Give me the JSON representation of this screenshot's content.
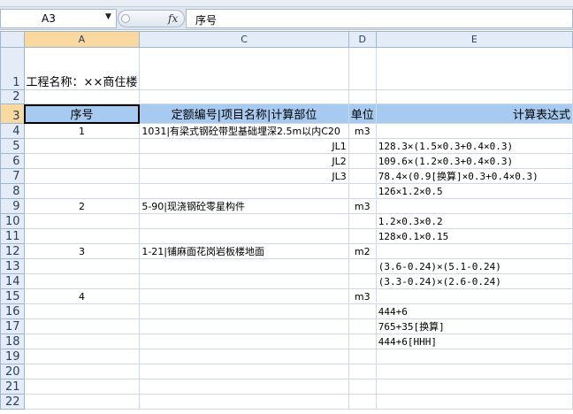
{
  "formula_bar": {
    "name_box": "A3",
    "fx_label": "fx",
    "formula": "序号"
  },
  "columns": [
    "",
    "A",
    "C",
    "D",
    "E"
  ],
  "rows": [
    {
      "n": "1",
      "a": "工程名称：××商住楼",
      "c": "",
      "d": "",
      "e": ""
    },
    {
      "n": "2",
      "a": "",
      "c": "",
      "d": "",
      "e": ""
    },
    {
      "n": "3",
      "a": "序号",
      "c": "定额编号|项目名称|计算部位",
      "d": "单位",
      "e": "计算表达式"
    },
    {
      "n": "4",
      "a": "1",
      "c": "1031|有梁式钢砼带型基础埋深2.5m以内C20",
      "d": "m3",
      "e": ""
    },
    {
      "n": "5",
      "a": "",
      "c": "JL1",
      "d": "",
      "e": "128.3×(1.5×0.3+0.4×0.3)"
    },
    {
      "n": "6",
      "a": "",
      "c": "JL2",
      "d": "",
      "e": "109.6×(1.2×0.3+0.4×0.3)"
    },
    {
      "n": "7",
      "a": "",
      "c": "JL3",
      "d": "",
      "e": "78.4×(0.9[换算]×0.3+0.4×0.3)"
    },
    {
      "n": "8",
      "a": "",
      "c": "",
      "d": "",
      "e": "126×1.2×0.5"
    },
    {
      "n": "9",
      "a": "2",
      "c": "5-90|现浇钢砼零星构件",
      "d": "m3",
      "e": ""
    },
    {
      "n": "10",
      "a": "",
      "c": "",
      "d": "",
      "e": "1.2×0.3×0.2"
    },
    {
      "n": "11",
      "a": "",
      "c": "",
      "d": "",
      "e": "128×0.1×0.15"
    },
    {
      "n": "12",
      "a": "3",
      "c": "1-21|铺麻面花岗岩板楼地面",
      "d": "m2",
      "e": ""
    },
    {
      "n": "13",
      "a": "",
      "c": "",
      "d": "",
      "e": "(3.6-0.24)×(5.1-0.24)"
    },
    {
      "n": "14",
      "a": "",
      "c": "",
      "d": "",
      "e": "(3.3-0.24)×(2.6-0.24)"
    },
    {
      "n": "15",
      "a": "4",
      "c": "",
      "d": "m3",
      "e": ""
    },
    {
      "n": "16",
      "a": "",
      "c": "",
      "d": "",
      "e": "444+6"
    },
    {
      "n": "17",
      "a": "",
      "c": "",
      "d": "",
      "e": "765+35[换算]"
    },
    {
      "n": "18",
      "a": "",
      "c": "",
      "d": "",
      "e": "444+6[HHH]"
    },
    {
      "n": "19",
      "a": "",
      "c": "",
      "d": "",
      "e": ""
    },
    {
      "n": "20",
      "a": "",
      "c": "",
      "d": "",
      "e": ""
    },
    {
      "n": "21",
      "a": "",
      "c": "",
      "d": "",
      "e": ""
    },
    {
      "n": "22",
      "a": "",
      "c": "",
      "d": "",
      "e": ""
    }
  ],
  "colors": {
    "header_row_fill": "#a6caf0",
    "selected_header": "#f9d99f"
  }
}
